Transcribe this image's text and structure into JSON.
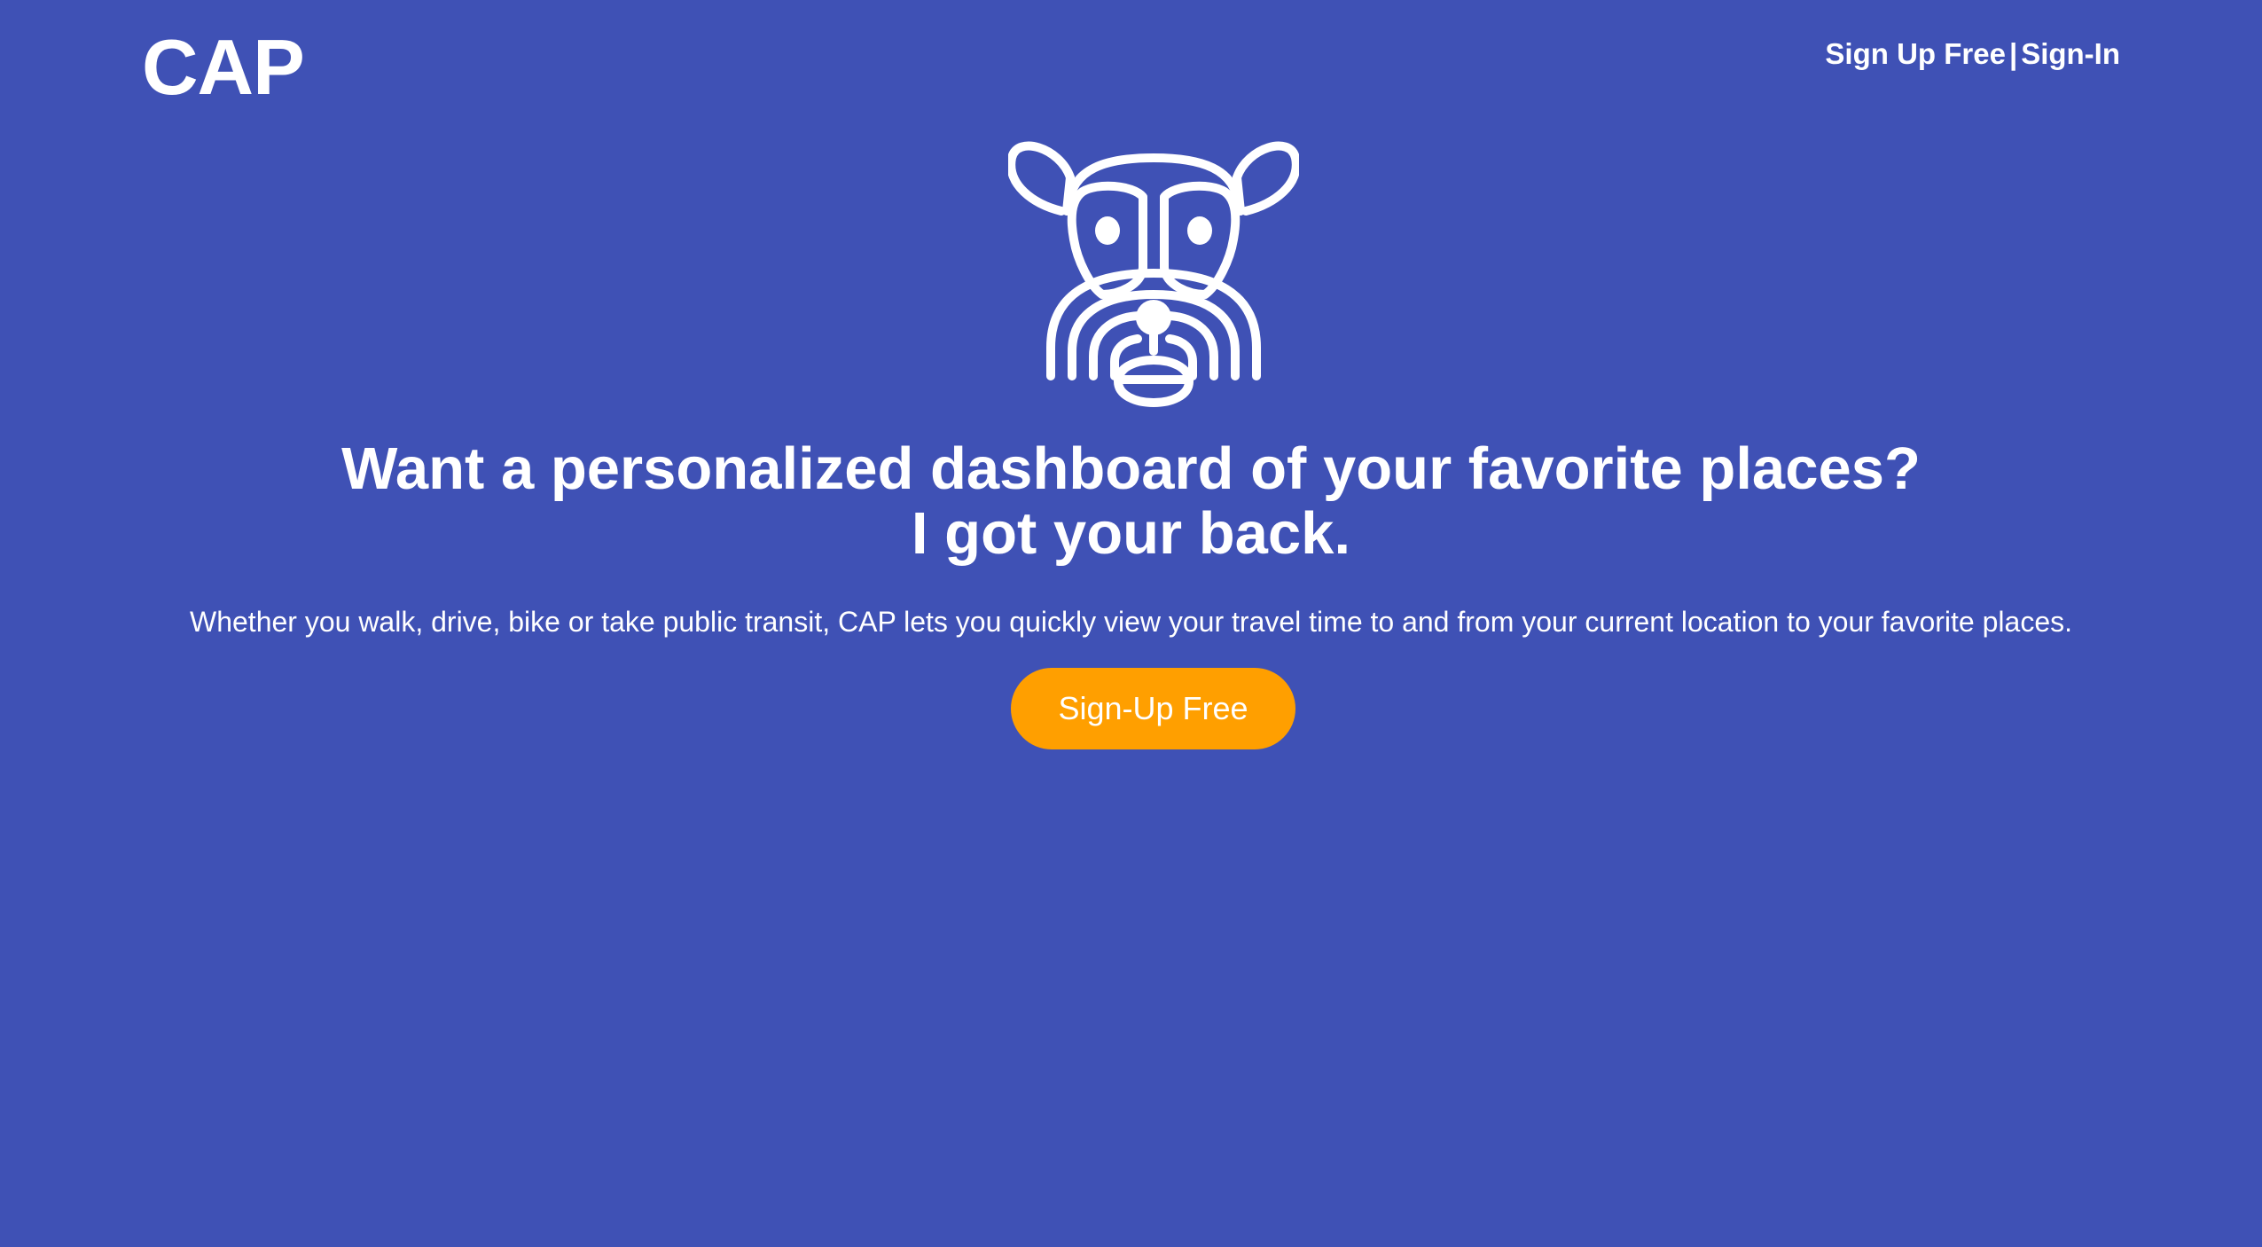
{
  "colors": {
    "background": "#3F51B5",
    "text": "#FFFFFF",
    "cta_background": "#FF9F00"
  },
  "header": {
    "logo": "CAP",
    "signup_link": "Sign Up Free",
    "separator": "|",
    "signin_link": "Sign-In"
  },
  "hero": {
    "mascot_icon": "dog-face-icon",
    "headline_line1": "Want a personalized dashboard of your favorite places?",
    "headline_line2": "I got your back.",
    "description": "Whether you walk, drive, bike or take public transit, CAP lets you quickly view your travel time to and from your current location to your favorite places.",
    "cta_label": "Sign-Up Free"
  }
}
